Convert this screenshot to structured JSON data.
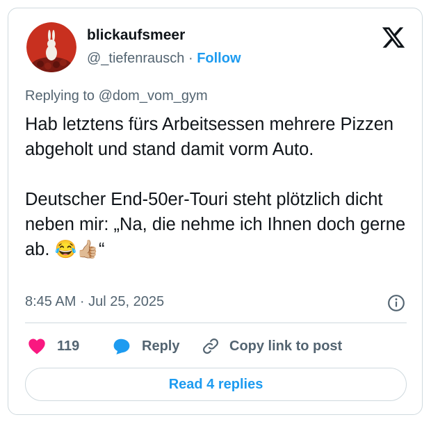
{
  "author": {
    "display_name": "blickaufsmeer",
    "handle": "@_tiefenrausch",
    "separator": "·",
    "follow_label": "Follow",
    "avatar_icon": "rabbit-avatar-icon"
  },
  "brand": {
    "logo_icon": "x-logo-icon"
  },
  "tweet": {
    "replying_to": "Replying to @dom_vom_gym",
    "text": "Hab letztens fürs Arbeitsessen mehrere Pizzen abgeholt und stand damit vorm Auto.\n\nDeutscher End-50er-Touri steht plötzlich dicht neben mir: „Na, die nehme ich Ihnen doch gerne ab. 😂👍🏼“",
    "timestamp": "8:45 AM · Jul 25, 2025"
  },
  "actions": {
    "like_count": "119",
    "reply_label": "Reply",
    "copy_label": "Copy link to post"
  },
  "footer": {
    "read_replies_label": "Read 4 replies"
  },
  "colors": {
    "accent": "#1d9bf0",
    "like": "#f91880",
    "muted": "#536471",
    "text": "#0f1419",
    "border": "#cfd9de"
  }
}
